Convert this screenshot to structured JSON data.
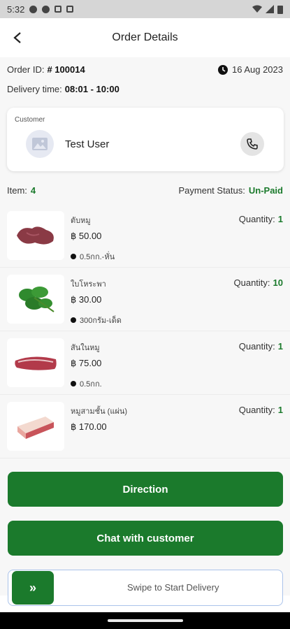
{
  "status_bar": {
    "time": "5:32"
  },
  "header": {
    "title": "Order Details",
    "back_icon": "arrow-left-icon"
  },
  "order": {
    "id_label": "Order ID:",
    "id_value": "# 100014",
    "date": "16 Aug 2023",
    "delivery_label": "Delivery time:",
    "delivery_value": "08:01 - 10:00"
  },
  "customer": {
    "section_label": "Customer",
    "name": "Test User",
    "avatar_icon": "image-placeholder-icon",
    "call_icon": "phone-icon"
  },
  "summary": {
    "item_label": "Item:",
    "item_count": "4",
    "payment_label": "Payment Status:",
    "payment_status": "Un-Paid"
  },
  "items": [
    {
      "name": "ตับหมู",
      "price": "฿ 50.00",
      "unit": "0.5กก.-หั่น",
      "qty_label": "Quantity:",
      "qty": "1"
    },
    {
      "name": "ใบโหระพา",
      "price": "฿ 30.00",
      "unit": "300กรัม-เด็ด",
      "qty_label": "Quantity:",
      "qty": "10"
    },
    {
      "name": "สันในหมู",
      "price": "฿ 75.00",
      "unit": "0.5กก.",
      "qty_label": "Quantity:",
      "qty": "1"
    },
    {
      "name": "หมูสามชั้น (แผ่น)",
      "price": "฿ 170.00",
      "unit": "",
      "qty_label": "Quantity:",
      "qty": "1"
    }
  ],
  "actions": {
    "direction": "Direction",
    "chat": "Chat with customer",
    "swipe_text": "Swipe to Start Delivery",
    "swipe_icon": "double-chevron-right-icon"
  },
  "colors": {
    "primary": "#1b7a2c",
    "background": "#f7f7f7"
  }
}
